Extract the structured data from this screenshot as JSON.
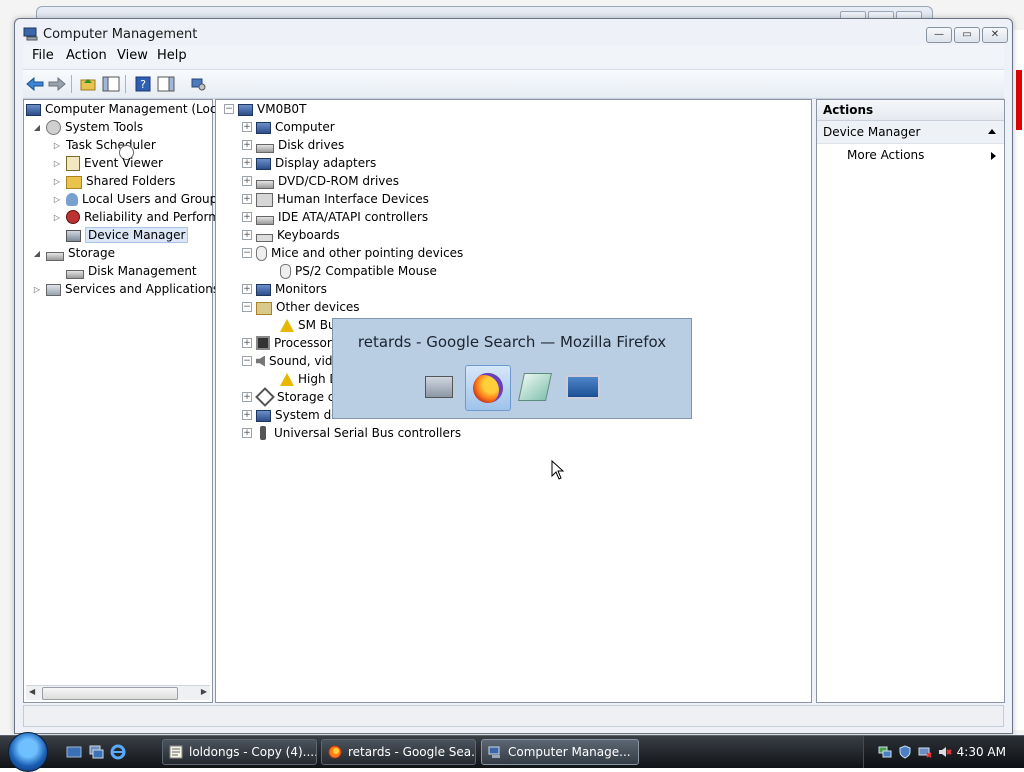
{
  "window": {
    "title": "Computer Management",
    "minimize": "—",
    "maximize": "▭",
    "close": "✕"
  },
  "menu": [
    "File",
    "Action",
    "View",
    "Help"
  ],
  "left_tree": [
    {
      "label": "Computer Management (Local",
      "level": 0,
      "expander": "",
      "icon": "computer-management-icon"
    },
    {
      "label": "System Tools",
      "level": 1,
      "expander": "◢",
      "icon": "system-tools-icon"
    },
    {
      "label": "Task Scheduler",
      "level": 2,
      "expander": "▷",
      "icon": "clock-icon"
    },
    {
      "label": "Event Viewer",
      "level": 2,
      "expander": "▷",
      "icon": "event-viewer-icon"
    },
    {
      "label": "Shared Folders",
      "level": 2,
      "expander": "▷",
      "icon": "shared-folder-icon"
    },
    {
      "label": "Local Users and Groups",
      "level": 2,
      "expander": "▷",
      "icon": "users-icon"
    },
    {
      "label": "Reliability and Performa",
      "level": 2,
      "expander": "▷",
      "icon": "reliability-icon"
    },
    {
      "label": "Device Manager",
      "level": 2,
      "expander": "",
      "icon": "device-manager-icon",
      "selected": true
    },
    {
      "label": "Storage",
      "level": 1,
      "expander": "◢",
      "icon": "storage-icon"
    },
    {
      "label": "Disk Management",
      "level": 2,
      "expander": "",
      "icon": "disk-icon"
    },
    {
      "label": "Services and Applications",
      "level": 1,
      "expander": "▷",
      "icon": "services-icon"
    }
  ],
  "device_tree": [
    {
      "label": "VM0B0T",
      "level": 0,
      "expander": "−",
      "icon": "computer-icon"
    },
    {
      "label": "Computer",
      "level": 1,
      "expander": "+",
      "icon": "computer-icon"
    },
    {
      "label": "Disk drives",
      "level": 1,
      "expander": "+",
      "icon": "disk-drive-icon"
    },
    {
      "label": "Display adapters",
      "level": 1,
      "expander": "+",
      "icon": "display-adapter-icon"
    },
    {
      "label": "DVD/CD-ROM drives",
      "level": 1,
      "expander": "+",
      "icon": "dvd-icon"
    },
    {
      "label": "Human Interface Devices",
      "level": 1,
      "expander": "+",
      "icon": "hid-icon"
    },
    {
      "label": "IDE ATA/ATAPI controllers",
      "level": 1,
      "expander": "+",
      "icon": "ide-icon"
    },
    {
      "label": "Keyboards",
      "level": 1,
      "expander": "+",
      "icon": "keyboard-icon"
    },
    {
      "label": "Mice and other pointing devices",
      "level": 1,
      "expander": "−",
      "icon": "mouse-icon"
    },
    {
      "label": "PS/2 Compatible Mouse",
      "level": 2,
      "expander": "",
      "icon": "mouse-icon"
    },
    {
      "label": "Monitors",
      "level": 1,
      "expander": "+",
      "icon": "monitor-icon"
    },
    {
      "label": "Other devices",
      "level": 1,
      "expander": "−",
      "icon": "unknown-device-icon"
    },
    {
      "label": "SM Bu",
      "level": 2,
      "expander": "",
      "icon": "warning-icon"
    },
    {
      "label": "Processors",
      "level": 1,
      "expander": "+",
      "icon": "processor-icon"
    },
    {
      "label": "Sound, vid",
      "level": 1,
      "expander": "−",
      "icon": "speaker-icon"
    },
    {
      "label": "High D",
      "level": 2,
      "expander": "",
      "icon": "warning-icon"
    },
    {
      "label": "Storage co",
      "level": 1,
      "expander": "+",
      "icon": "storage-controller-icon"
    },
    {
      "label": "System de",
      "level": 1,
      "expander": "+",
      "icon": "system-device-icon"
    },
    {
      "label": "Universal Serial Bus controllers",
      "level": 1,
      "expander": "+",
      "icon": "usb-icon"
    }
  ],
  "actions": {
    "header": "Actions",
    "section": "Device Manager",
    "item": "More Actions"
  },
  "switcher": {
    "title": "retards - Google Search — Mozilla Firefox",
    "icons": [
      "computer-management-icon",
      "firefox-icon",
      "notebook-icon",
      "desktop-icon"
    ]
  },
  "taskbar": {
    "buttons": [
      {
        "label": "loldongs - Copy (4)....",
        "icon": "notepad-icon"
      },
      {
        "label": "retards - Google Sea...",
        "icon": "firefox-icon"
      },
      {
        "label": "Computer Manage...",
        "icon": "computer-management-icon",
        "active": true
      }
    ],
    "clock": "4:30 AM"
  }
}
